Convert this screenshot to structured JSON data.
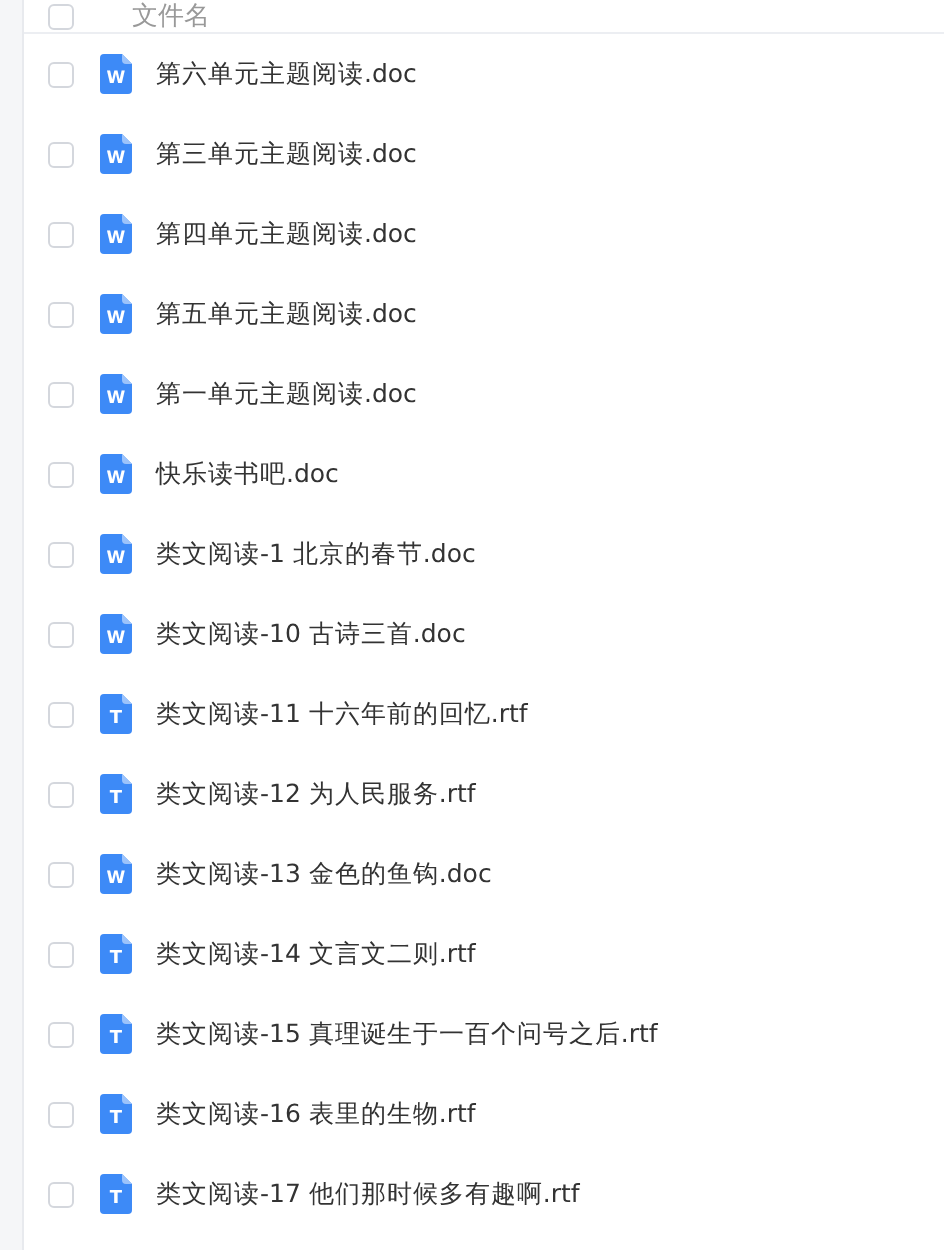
{
  "header": {
    "checked": false,
    "label": "文件名"
  },
  "files": [
    {
      "name": "第六单元主题阅读.doc",
      "kind": "word",
      "icon": "W",
      "checked": false
    },
    {
      "name": "第三单元主题阅读.doc",
      "kind": "word",
      "icon": "W",
      "checked": false
    },
    {
      "name": "第四单元主题阅读.doc",
      "kind": "word",
      "icon": "W",
      "checked": false
    },
    {
      "name": "第五单元主题阅读.doc",
      "kind": "word",
      "icon": "W",
      "checked": false
    },
    {
      "name": "第一单元主题阅读.doc",
      "kind": "word",
      "icon": "W",
      "checked": false
    },
    {
      "name": "快乐读书吧.doc",
      "kind": "word",
      "icon": "W",
      "checked": false
    },
    {
      "name": "类文阅读-1 北京的春节.doc",
      "kind": "word",
      "icon": "W",
      "checked": false
    },
    {
      "name": "类文阅读-10 古诗三首.doc",
      "kind": "word",
      "icon": "W",
      "checked": false
    },
    {
      "name": "类文阅读-11 十六年前的回忆.rtf",
      "kind": "text",
      "icon": "T",
      "checked": false
    },
    {
      "name": "类文阅读-12 为人民服务.rtf",
      "kind": "text",
      "icon": "T",
      "checked": false
    },
    {
      "name": "类文阅读-13 金色的鱼钩.doc",
      "kind": "word",
      "icon": "W",
      "checked": false
    },
    {
      "name": "类文阅读-14 文言文二则.rtf",
      "kind": "text",
      "icon": "T",
      "checked": false
    },
    {
      "name": "类文阅读-15 真理诞生于一百个问号之后.rtf",
      "kind": "text",
      "icon": "T",
      "checked": false
    },
    {
      "name": "类文阅读-16 表里的生物.rtf",
      "kind": "text",
      "icon": "T",
      "checked": false
    },
    {
      "name": "类文阅读-17 他们那时候多有趣啊.rtf",
      "kind": "text",
      "icon": "T",
      "checked": false
    }
  ]
}
